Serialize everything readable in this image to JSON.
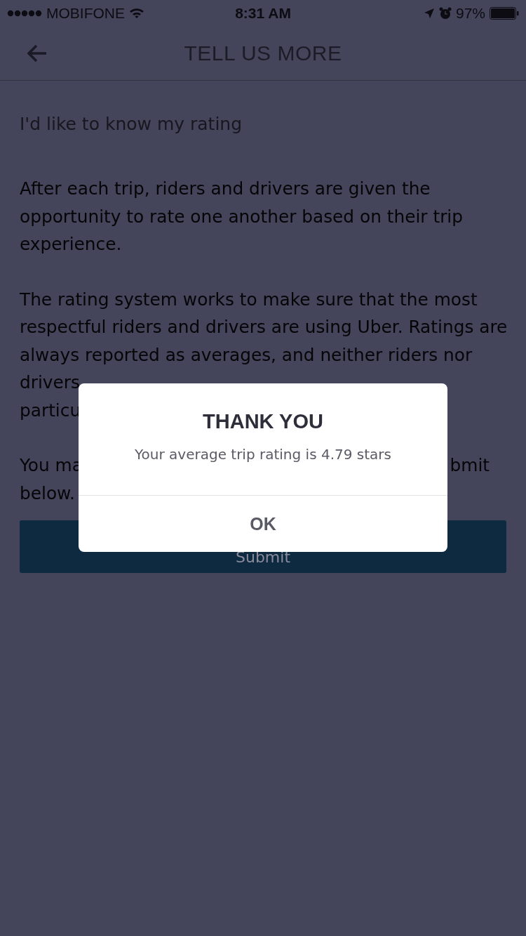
{
  "status_bar": {
    "carrier": "MOBIFONE",
    "time": "8:31 AM",
    "battery": "97%"
  },
  "header": {
    "title": "TELL US MORE"
  },
  "heading": "I'd like to know my rating",
  "paragraph_1": "After each trip, riders and drivers are given the opportunity to rate one another based on their trip experience.",
  "paragraph_2_visible": "The rating system works to make sure that the most respectful riders and drivers are using Uber. Ratings are always reported as averages, and neither riders nor drivers",
  "line_fragments": [
    {
      "left": "particu"
    },
    {
      "left": "You ma",
      "right": "bmit"
    },
    {
      "left": "below."
    }
  ],
  "submit_button": "Submit",
  "dialog": {
    "title": "THANK YOU",
    "message": "Your average trip rating is 4.79 stars",
    "button": "OK"
  }
}
